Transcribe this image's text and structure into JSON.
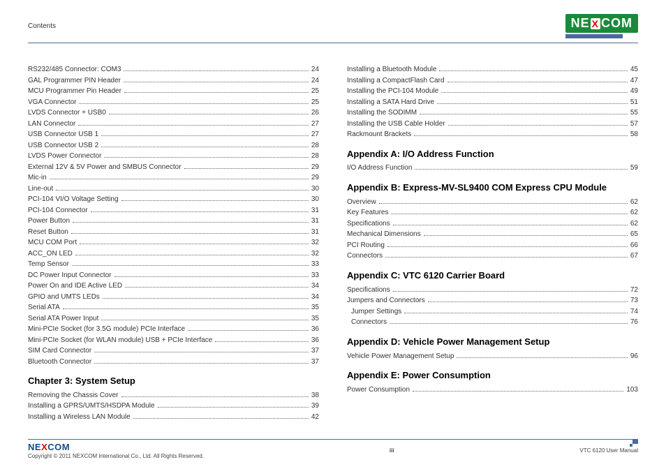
{
  "header": {
    "label": "Contents",
    "brand_left": "NE",
    "brand_x": "X",
    "brand_right": "COM"
  },
  "left_col": {
    "items": [
      {
        "t": "RS232/485 Connector: COM3",
        "p": "24"
      },
      {
        "t": "GAL Programmer PIN Header",
        "p": "24"
      },
      {
        "t": "MCU Programmer Pin Header",
        "p": "25"
      },
      {
        "t": "VGA Connector",
        "p": "25"
      },
      {
        "t": "LVDS Connector + USB0",
        "p": "26"
      },
      {
        "t": "LAN Connector",
        "p": "27"
      },
      {
        "t": "USB Connector USB 1",
        "p": "27"
      },
      {
        "t": "USB Connector USB 2",
        "p": "28"
      },
      {
        "t": "LVDS Power Connector",
        "p": "28"
      },
      {
        "t": "External 12V & 5V Power and SMBUS Connector",
        "p": "29"
      },
      {
        "t": "Mic-in",
        "p": "29"
      },
      {
        "t": "Line-out",
        "p": "30"
      },
      {
        "t": "PCI-104 VI/O Voltage Setting",
        "p": "30"
      },
      {
        "t": "PCI-104 Connector",
        "p": "31"
      },
      {
        "t": "Power Button",
        "p": "31"
      },
      {
        "t": "Reset Button",
        "p": "31"
      },
      {
        "t": "MCU COM Port",
        "p": "32"
      },
      {
        "t": "ACC_ON LED",
        "p": "32"
      },
      {
        "t": "Temp Sensor",
        "p": "33"
      },
      {
        "t": "DC Power Input Connector",
        "p": "33"
      },
      {
        "t": "Power On and IDE Active LED",
        "p": "34"
      },
      {
        "t": "GPIO and UMTS LEDs",
        "p": "34"
      },
      {
        "t": "Serial ATA",
        "p": "35"
      },
      {
        "t": "Serial ATA Power Input",
        "p": "35"
      },
      {
        "t": "Mini-PCIe Socket (for 3.5G module) PCIe Interface",
        "p": "36"
      },
      {
        "t": "Mini-PCIe Socket (for WLAN module) USB + PCIe Interface",
        "p": "36"
      },
      {
        "t": "SIM Card Connector",
        "p": "37"
      },
      {
        "t": "Bluetooth Connector",
        "p": "37"
      }
    ],
    "chapter3": {
      "heading": "Chapter 3: System Setup",
      "items": [
        {
          "t": "Removing the Chassis Cover",
          "p": "38"
        },
        {
          "t": "Installing a GPRS/UMTS/HSDPA Module",
          "p": "39"
        },
        {
          "t": "Installing a Wireless LAN Module",
          "p": "42"
        }
      ]
    }
  },
  "right_col": {
    "top_items": [
      {
        "t": "Installing a Bluetooth Module",
        "p": "45"
      },
      {
        "t": "Installing a CompactFlash Card",
        "p": "47"
      },
      {
        "t": "Installing the PCI-104 Module",
        "p": "49"
      },
      {
        "t": "Installing a SATA Hard Drive",
        "p": "51"
      },
      {
        "t": "Installing the SODIMM",
        "p": "55"
      },
      {
        "t": "Installing the USB Cable Holder",
        "p": "57"
      },
      {
        "t": "Rackmount Brackets",
        "p": "58"
      }
    ],
    "appA": {
      "heading": "Appendix A: I/O Address Function",
      "items": [
        {
          "t": "I/O Address Function",
          "p": "59"
        }
      ]
    },
    "appB": {
      "heading": "Appendix B: Express-MV-SL9400 COM Express CPU Module",
      "items": [
        {
          "t": "Overview",
          "p": "62"
        },
        {
          "t": "Key Features",
          "p": "62"
        },
        {
          "t": "Specifications",
          "p": "62"
        },
        {
          "t": "Mechanical Dimensions",
          "p": "65"
        },
        {
          "t": "PCI Routing",
          "p": "66"
        },
        {
          "t": "Connectors",
          "p": "67"
        }
      ]
    },
    "appC": {
      "heading": "Appendix C: VTC 6120 Carrier Board",
      "items": [
        {
          "t": "Specifications",
          "p": "72"
        },
        {
          "t": "Jumpers and Connectors",
          "p": "73"
        },
        {
          "t": "Jumper Settings",
          "p": "74",
          "indent": true
        },
        {
          "t": "Connectors",
          "p": "76",
          "indent": true
        }
      ]
    },
    "appD": {
      "heading": "Appendix D: Vehicle Power Management Setup",
      "items": [
        {
          "t": "Vehicle Power Management Setup",
          "p": "96"
        }
      ]
    },
    "appE": {
      "heading": "Appendix E: Power Consumption",
      "items": [
        {
          "t": "Power Consumption",
          "p": "103"
        }
      ]
    }
  },
  "footer": {
    "brand": "NE",
    "brand_x": "X",
    "brand_rest": "COM",
    "copyright": "Copyright © 2011 NEXCOM International Co., Ltd. All Rights Reserved.",
    "page": "iii",
    "doc": "VTC 6120 User Manual"
  }
}
